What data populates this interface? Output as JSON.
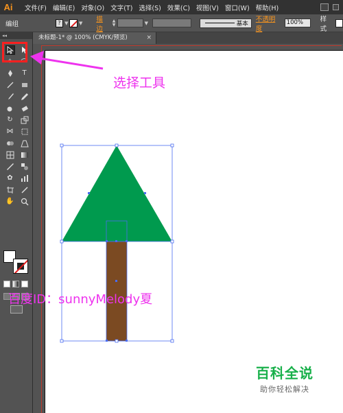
{
  "app": {
    "logo": "Ai"
  },
  "menu": [
    "文件(F)",
    "编辑(E)",
    "对象(O)",
    "文字(T)",
    "选择(S)",
    "效果(C)",
    "视图(V)",
    "窗口(W)",
    "帮助(H)"
  ],
  "controlbar": {
    "selection_label": "编组",
    "stroke_link": "描边",
    "stroke_profile": "基本",
    "opacity_link": "不透明度",
    "opacity_value": "100%",
    "style_label": "样式"
  },
  "document_tab": {
    "title": "未标题-1* @ 100% (CMYK/预览)",
    "close": "×"
  },
  "tools_panel": {
    "header": "◂◂"
  },
  "annotations": {
    "select_tool": "选择工具",
    "author": "百度ID：sunnyMelody夏"
  },
  "watermark": {
    "title": "百科全说",
    "subtitle": "助你轻松解决"
  },
  "colors": {
    "tree_green": "#009a4e",
    "trunk_brown": "#7b4a22",
    "selection_blue": "#4a6cf0",
    "annotation_magenta": "#ee33ee",
    "highlight_red": "#ff2020",
    "logo_orange": "#f7941e"
  }
}
